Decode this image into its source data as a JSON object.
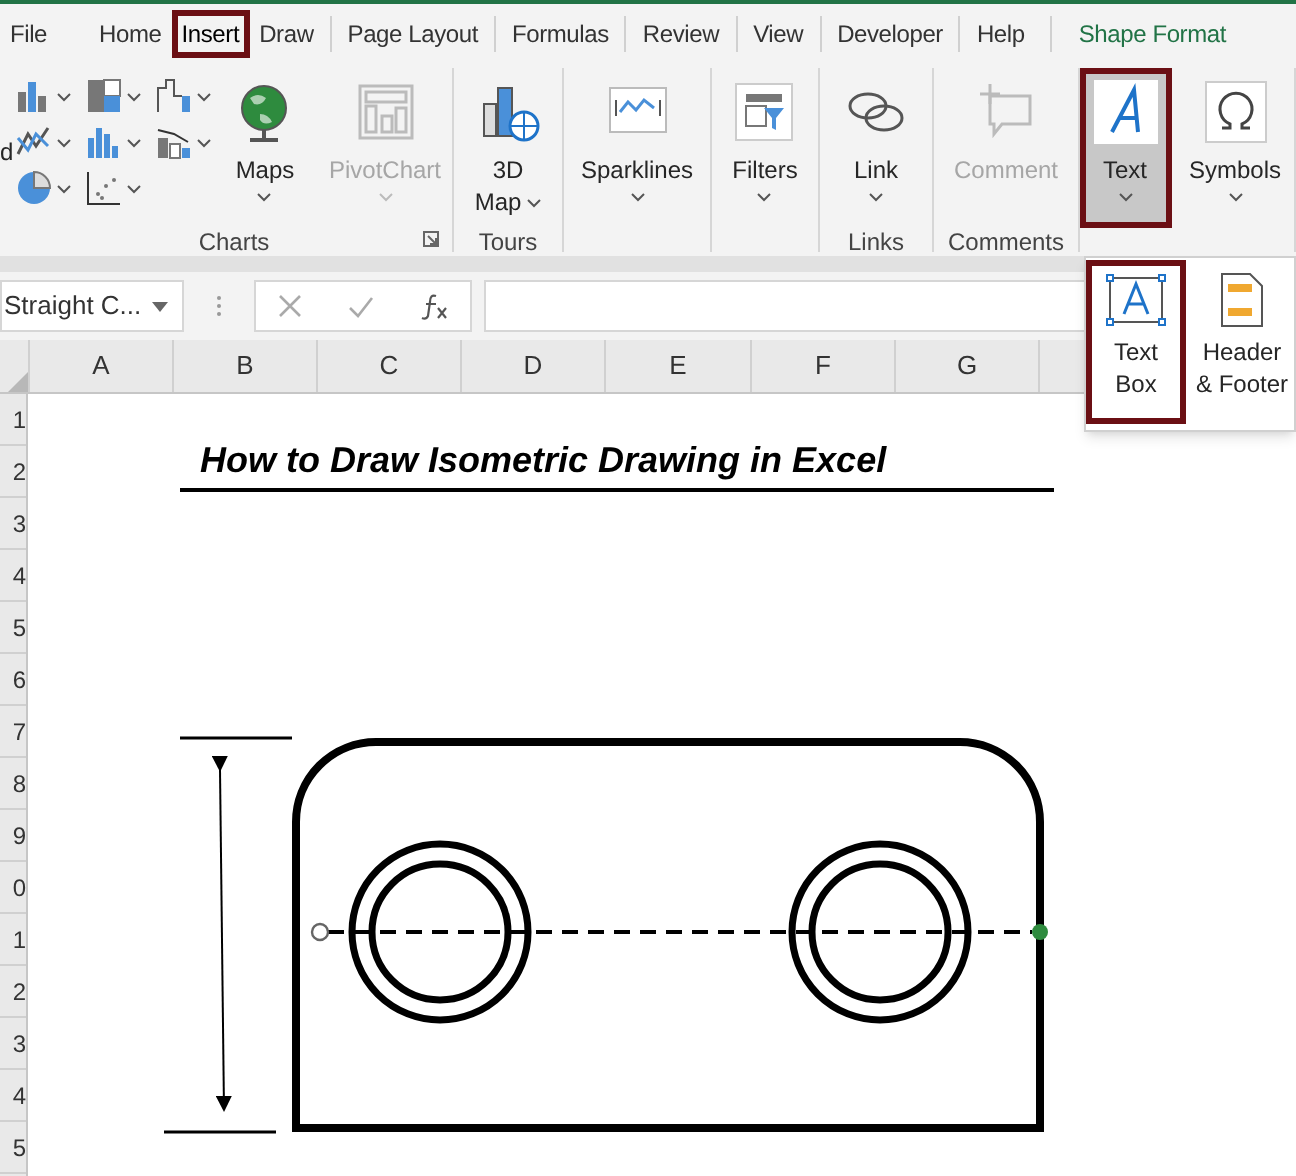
{
  "tabs": [
    {
      "label": "File",
      "selected": false,
      "highlighted": false
    },
    {
      "label": "Home",
      "selected": false,
      "highlighted": false
    },
    {
      "label": "Insert",
      "selected": true,
      "highlighted": true
    },
    {
      "label": "Draw",
      "selected": false,
      "highlighted": false
    },
    {
      "label": "Page Layout",
      "selected": false,
      "highlighted": false
    },
    {
      "label": "Formulas",
      "selected": false,
      "highlighted": false
    },
    {
      "label": "Review",
      "selected": false,
      "highlighted": false
    },
    {
      "label": "View",
      "selected": false,
      "highlighted": false
    },
    {
      "label": "Developer",
      "selected": false,
      "highlighted": false
    },
    {
      "label": "Help",
      "selected": false,
      "highlighted": false
    },
    {
      "label": "Shape Format",
      "selected": false,
      "highlighted": false,
      "kind": "contextual"
    }
  ],
  "ribbon": {
    "cut_label": "d",
    "groups": [
      {
        "label": "Charts",
        "buttons": [
          {
            "label": "Maps",
            "disabled": false,
            "selected": false,
            "highlighted": false
          },
          {
            "label": "PivotChart",
            "disabled": true,
            "selected": false,
            "highlighted": false
          }
        ]
      },
      {
        "label": "Tours",
        "buttons": [
          {
            "label": "3D Map",
            "disabled": false,
            "selected": false,
            "highlighted": false
          }
        ]
      },
      {
        "buttons": [
          {
            "label": "Sparklines",
            "disabled": false,
            "selected": false,
            "highlighted": false
          }
        ]
      },
      {
        "buttons": [
          {
            "label": "Filters",
            "disabled": false,
            "selected": false,
            "highlighted": false
          }
        ]
      },
      {
        "label": "Links",
        "buttons": [
          {
            "label": "Link",
            "disabled": false,
            "selected": false,
            "highlighted": false
          }
        ]
      },
      {
        "label": "Comments",
        "buttons": [
          {
            "label": "Comment",
            "disabled": true,
            "selected": false,
            "highlighted": false
          }
        ]
      },
      {
        "buttons": [
          {
            "label": "Text",
            "disabled": false,
            "selected": true,
            "highlighted": true
          },
          {
            "label": "Symbols",
            "disabled": false,
            "selected": false,
            "highlighted": false
          }
        ]
      }
    ]
  },
  "text_menu": [
    {
      "label": "Text Box",
      "highlighted": true
    },
    {
      "label": "Header & Footer",
      "highlighted": false
    }
  ],
  "name_box": "Straight C...",
  "columns": [
    "A",
    "B",
    "C",
    "D",
    "E",
    "F",
    "G"
  ],
  "rows": [
    "1",
    "2",
    "3",
    "4",
    "5",
    "6",
    "7",
    "8",
    "9",
    "0",
    "1",
    "2",
    "3",
    "4",
    "5"
  ],
  "sheet_title": "How to Draw Isometric Drawing in Excel"
}
